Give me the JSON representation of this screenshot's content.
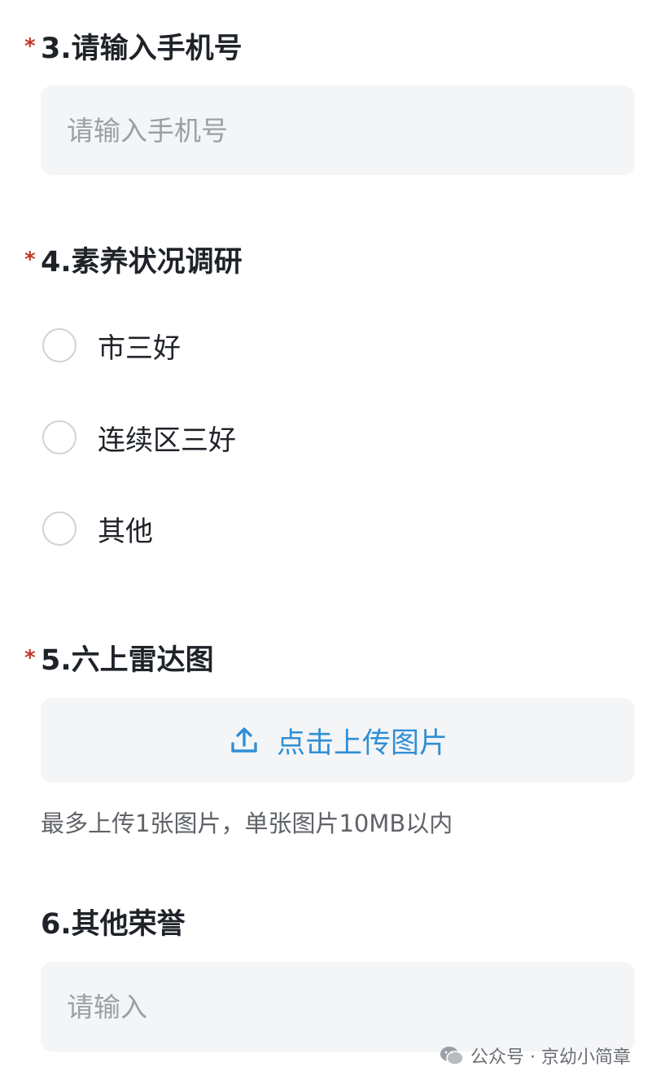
{
  "questions": {
    "q3": {
      "required_mark": "*",
      "title": "3.请输入手机号",
      "placeholder": "请输入手机号"
    },
    "q4": {
      "required_mark": "*",
      "title": "4.素养状况调研",
      "options": [
        "市三好",
        "连续区三好",
        "其他"
      ]
    },
    "q5": {
      "required_mark": "*",
      "title": "5.六上雷达图",
      "upload_label": "点击上传图片",
      "hint": "最多上传1张图片，单张图片10MB以内"
    },
    "q6": {
      "title": "6.其他荣誉",
      "placeholder": "请输入"
    }
  },
  "watermark": {
    "text": "公众号 · 京幼小简章",
    "icon": "wechat-icon"
  },
  "colors": {
    "required": "#c0392b",
    "accent": "#2f8fd6",
    "input_bg": "#f4f5f7"
  }
}
